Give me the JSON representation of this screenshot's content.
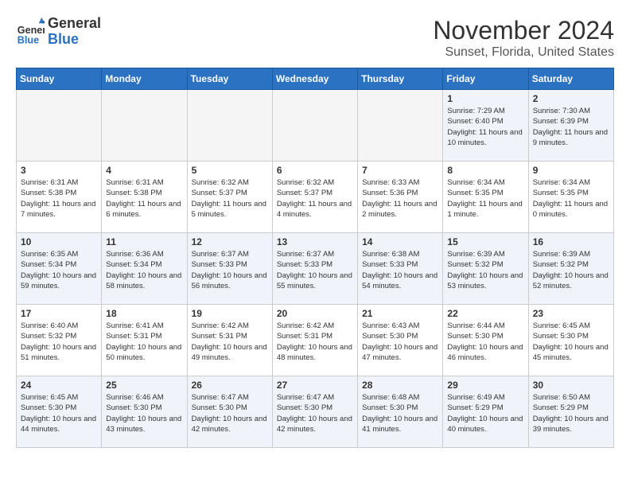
{
  "logo": {
    "text_general": "General",
    "text_blue": "Blue"
  },
  "calendar": {
    "title": "November 2024",
    "subtitle": "Sunset, Florida, United States",
    "days_of_week": [
      "Sunday",
      "Monday",
      "Tuesday",
      "Wednesday",
      "Thursday",
      "Friday",
      "Saturday"
    ],
    "weeks": [
      [
        {
          "day": "",
          "info": ""
        },
        {
          "day": "",
          "info": ""
        },
        {
          "day": "",
          "info": ""
        },
        {
          "day": "",
          "info": ""
        },
        {
          "day": "",
          "info": ""
        },
        {
          "day": "1",
          "info": "Sunrise: 7:29 AM\nSunset: 6:40 PM\nDaylight: 11 hours and 10 minutes."
        },
        {
          "day": "2",
          "info": "Sunrise: 7:30 AM\nSunset: 6:39 PM\nDaylight: 11 hours and 9 minutes."
        }
      ],
      [
        {
          "day": "3",
          "info": "Sunrise: 6:31 AM\nSunset: 5:38 PM\nDaylight: 11 hours and 7 minutes."
        },
        {
          "day": "4",
          "info": "Sunrise: 6:31 AM\nSunset: 5:38 PM\nDaylight: 11 hours and 6 minutes."
        },
        {
          "day": "5",
          "info": "Sunrise: 6:32 AM\nSunset: 5:37 PM\nDaylight: 11 hours and 5 minutes."
        },
        {
          "day": "6",
          "info": "Sunrise: 6:32 AM\nSunset: 5:37 PM\nDaylight: 11 hours and 4 minutes."
        },
        {
          "day": "7",
          "info": "Sunrise: 6:33 AM\nSunset: 5:36 PM\nDaylight: 11 hours and 2 minutes."
        },
        {
          "day": "8",
          "info": "Sunrise: 6:34 AM\nSunset: 5:35 PM\nDaylight: 11 hours and 1 minute."
        },
        {
          "day": "9",
          "info": "Sunrise: 6:34 AM\nSunset: 5:35 PM\nDaylight: 11 hours and 0 minutes."
        }
      ],
      [
        {
          "day": "10",
          "info": "Sunrise: 6:35 AM\nSunset: 5:34 PM\nDaylight: 10 hours and 59 minutes."
        },
        {
          "day": "11",
          "info": "Sunrise: 6:36 AM\nSunset: 5:34 PM\nDaylight: 10 hours and 58 minutes."
        },
        {
          "day": "12",
          "info": "Sunrise: 6:37 AM\nSunset: 5:33 PM\nDaylight: 10 hours and 56 minutes."
        },
        {
          "day": "13",
          "info": "Sunrise: 6:37 AM\nSunset: 5:33 PM\nDaylight: 10 hours and 55 minutes."
        },
        {
          "day": "14",
          "info": "Sunrise: 6:38 AM\nSunset: 5:33 PM\nDaylight: 10 hours and 54 minutes."
        },
        {
          "day": "15",
          "info": "Sunrise: 6:39 AM\nSunset: 5:32 PM\nDaylight: 10 hours and 53 minutes."
        },
        {
          "day": "16",
          "info": "Sunrise: 6:39 AM\nSunset: 5:32 PM\nDaylight: 10 hours and 52 minutes."
        }
      ],
      [
        {
          "day": "17",
          "info": "Sunrise: 6:40 AM\nSunset: 5:32 PM\nDaylight: 10 hours and 51 minutes."
        },
        {
          "day": "18",
          "info": "Sunrise: 6:41 AM\nSunset: 5:31 PM\nDaylight: 10 hours and 50 minutes."
        },
        {
          "day": "19",
          "info": "Sunrise: 6:42 AM\nSunset: 5:31 PM\nDaylight: 10 hours and 49 minutes."
        },
        {
          "day": "20",
          "info": "Sunrise: 6:42 AM\nSunset: 5:31 PM\nDaylight: 10 hours and 48 minutes."
        },
        {
          "day": "21",
          "info": "Sunrise: 6:43 AM\nSunset: 5:30 PM\nDaylight: 10 hours and 47 minutes."
        },
        {
          "day": "22",
          "info": "Sunrise: 6:44 AM\nSunset: 5:30 PM\nDaylight: 10 hours and 46 minutes."
        },
        {
          "day": "23",
          "info": "Sunrise: 6:45 AM\nSunset: 5:30 PM\nDaylight: 10 hours and 45 minutes."
        }
      ],
      [
        {
          "day": "24",
          "info": "Sunrise: 6:45 AM\nSunset: 5:30 PM\nDaylight: 10 hours and 44 minutes."
        },
        {
          "day": "25",
          "info": "Sunrise: 6:46 AM\nSunset: 5:30 PM\nDaylight: 10 hours and 43 minutes."
        },
        {
          "day": "26",
          "info": "Sunrise: 6:47 AM\nSunset: 5:30 PM\nDaylight: 10 hours and 42 minutes."
        },
        {
          "day": "27",
          "info": "Sunrise: 6:47 AM\nSunset: 5:30 PM\nDaylight: 10 hours and 42 minutes."
        },
        {
          "day": "28",
          "info": "Sunrise: 6:48 AM\nSunset: 5:30 PM\nDaylight: 10 hours and 41 minutes."
        },
        {
          "day": "29",
          "info": "Sunrise: 6:49 AM\nSunset: 5:29 PM\nDaylight: 10 hours and 40 minutes."
        },
        {
          "day": "30",
          "info": "Sunrise: 6:50 AM\nSunset: 5:29 PM\nDaylight: 10 hours and 39 minutes."
        }
      ]
    ]
  }
}
